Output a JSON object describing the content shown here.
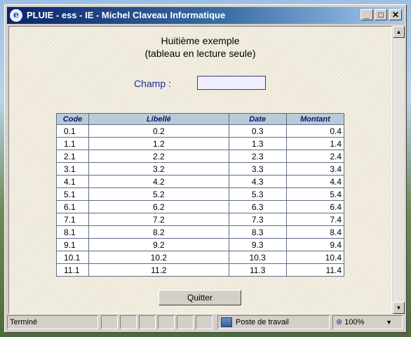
{
  "window": {
    "title": "PLUIE - ess - IE - Michel Claveau Informatique",
    "min_glyph": "_",
    "max_glyph": "□",
    "close_glyph": "✕",
    "icon_glyph": "e"
  },
  "page": {
    "heading_line1": "Huitième exemple",
    "heading_line2": "(tableau en lecture seule)",
    "field_label": "Champ :",
    "field_value": "",
    "quit_label": "Quitter"
  },
  "table": {
    "headers": [
      "Code",
      "Libellé",
      "Date",
      "Montant"
    ],
    "rows": [
      [
        "0.1",
        "0.2",
        "0.3",
        "0.4"
      ],
      [
        "1.1",
        "1.2",
        "1.3",
        "1.4"
      ],
      [
        "2.1",
        "2.2",
        "2.3",
        "2.4"
      ],
      [
        "3.1",
        "3.2",
        "3.3",
        "3.4"
      ],
      [
        "4.1",
        "4.2",
        "4.3",
        "4.4"
      ],
      [
        "5.1",
        "5.2",
        "5.3",
        "5.4"
      ],
      [
        "6.1",
        "6.2",
        "6.3",
        "6.4"
      ],
      [
        "7.1",
        "7.2",
        "7.3",
        "7.4"
      ],
      [
        "8.1",
        "8.2",
        "8.3",
        "8.4"
      ],
      [
        "9.1",
        "9.2",
        "9.3",
        "9.4"
      ],
      [
        "10.1",
        "10.2",
        "10.3",
        "10.4"
      ],
      [
        "11.1",
        "11.2",
        "11.3",
        "11.4"
      ]
    ]
  },
  "statusbar": {
    "status_text": "Terminé",
    "zone_text": "Poste de travail",
    "zoom_text": "100%",
    "zoom_arrow": "▼"
  },
  "scrollbar": {
    "up_glyph": "▲",
    "down_glyph": "▼"
  }
}
